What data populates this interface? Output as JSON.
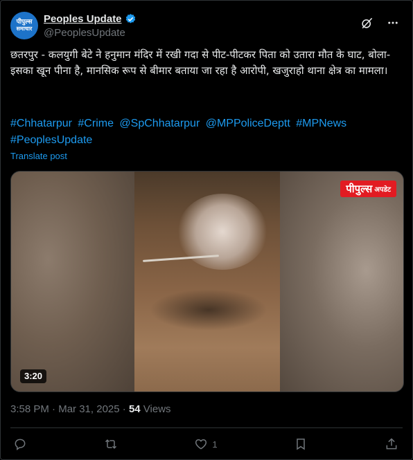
{
  "account": {
    "display_name": "Peoples Update",
    "handle": "@PeoplesUpdate",
    "avatar_line1": "पीपुल्स",
    "avatar_line2": "समाचार"
  },
  "post": {
    "text": "छतरपुर - कलयुगी बेटे ने हनुमान मंदिर में रखी गदा से पीट-पीटकर पिता को उतारा मौत के घाट, बोला- इसका खून पीना है, मानसिक रूप से बीमार बताया जा रहा है आरोपी, खजुराहो थाना क्षेत्र का मामला।",
    "hashtags": [
      "#Chhatarpur",
      "#Crime",
      "@SpChhatarpur",
      "@MPPoliceDeptt",
      "#MPNews",
      "#PeoplesUpdate"
    ],
    "translate_label": "Translate post"
  },
  "media": {
    "watermark_main": "पीपुल्स",
    "watermark_sub": "अपडेट",
    "duration": "3:20"
  },
  "meta": {
    "time": "3:58 PM",
    "separator": " · ",
    "date": "Mar 31, 2025",
    "views_count": "54",
    "views_label": " Views"
  },
  "actions": {
    "likes_count": "1"
  },
  "colors": {
    "accent": "#1d9bf0",
    "background": "#000000",
    "muted": "#71767b",
    "watermark_red": "#e21b22"
  },
  "icons": [
    "verified-badge-icon",
    "grok-icon",
    "more-icon",
    "reply-icon",
    "repost-icon",
    "like-icon",
    "bookmark-icon",
    "share-icon"
  ]
}
